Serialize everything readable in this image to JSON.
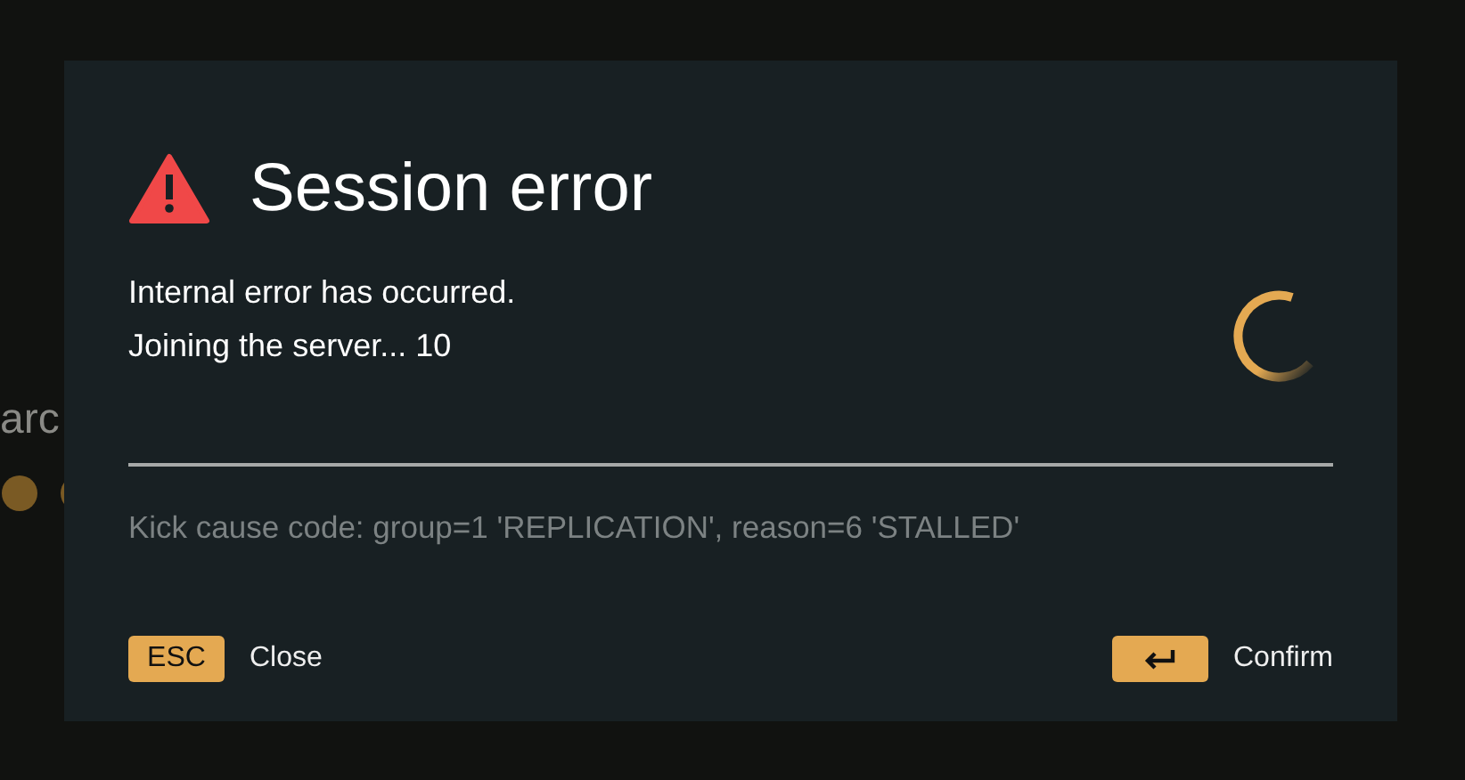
{
  "background": {
    "text": "arc"
  },
  "dialog": {
    "title": "Session error",
    "messages": [
      "Internal error has occurred.",
      "Joining the server... 10"
    ],
    "detail": "Kick cause code: group=1 'REPLICATION', reason=6 'STALLED'",
    "actions": [
      {
        "kind": "esc",
        "key": "ESC",
        "label": "Close"
      },
      {
        "kind": "enter",
        "label": "Confirm"
      }
    ]
  }
}
